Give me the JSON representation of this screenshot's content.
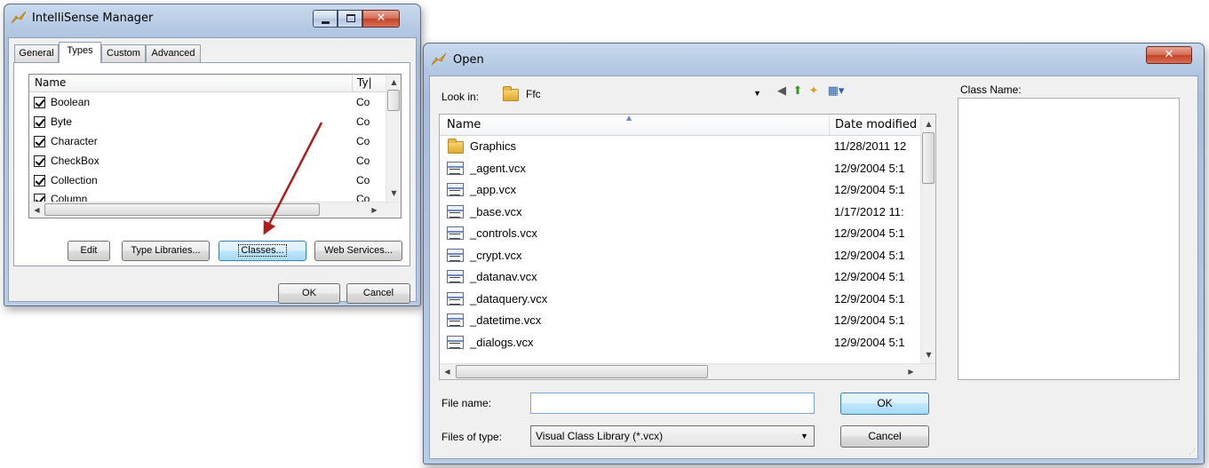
{
  "intellisense": {
    "title": "IntelliSense Manager",
    "tabs": [
      "General",
      "Types",
      "Custom",
      "Advanced"
    ],
    "columns": [
      "Name",
      "Ty|"
    ],
    "rows": [
      {
        "name": "Boolean",
        "type": "Co"
      },
      {
        "name": "Byte",
        "type": "Co"
      },
      {
        "name": "Character",
        "type": "Co"
      },
      {
        "name": "CheckBox",
        "type": "Co"
      },
      {
        "name": "Collection",
        "type": "Co"
      },
      {
        "name": "Column",
        "type": "Co"
      }
    ],
    "buttons": {
      "edit": "Edit",
      "type_libraries": "Type Libraries...",
      "classes": "Classes...",
      "web_services": "Web Services...",
      "ok": "OK",
      "cancel": "Cancel"
    }
  },
  "open_dialog": {
    "title": "Open",
    "look_in_label": "Look in:",
    "look_in_value": "Ffc",
    "class_name_label": "Class Name:",
    "columns": {
      "name": "Name",
      "date": "Date modified"
    },
    "files": [
      {
        "name": "Graphics",
        "date": "11/28/2011 12",
        "kind": "folder"
      },
      {
        "name": "_agent.vcx",
        "date": "12/9/2004 5:1",
        "kind": "vcx"
      },
      {
        "name": "_app.vcx",
        "date": "12/9/2004 5:1",
        "kind": "vcx"
      },
      {
        "name": "_base.vcx",
        "date": "1/17/2012 11:",
        "kind": "vcx"
      },
      {
        "name": "_controls.vcx",
        "date": "12/9/2004 5:1",
        "kind": "vcx"
      },
      {
        "name": "_crypt.vcx",
        "date": "12/9/2004 5:1",
        "kind": "vcx"
      },
      {
        "name": "_datanav.vcx",
        "date": "12/9/2004 5:1",
        "kind": "vcx"
      },
      {
        "name": "_dataquery.vcx",
        "date": "12/9/2004 5:1",
        "kind": "vcx"
      },
      {
        "name": "_datetime.vcx",
        "date": "12/9/2004 5:1",
        "kind": "vcx"
      },
      {
        "name": "_dialogs.vcx",
        "date": "12/9/2004 5:1",
        "kind": "vcx"
      }
    ],
    "file_name_label": "File name:",
    "file_name_value": "",
    "files_of_type_label": "Files of type:",
    "files_of_type_value": "Visual Class Library (*.vcx)",
    "ok": "OK",
    "cancel": "Cancel"
  }
}
